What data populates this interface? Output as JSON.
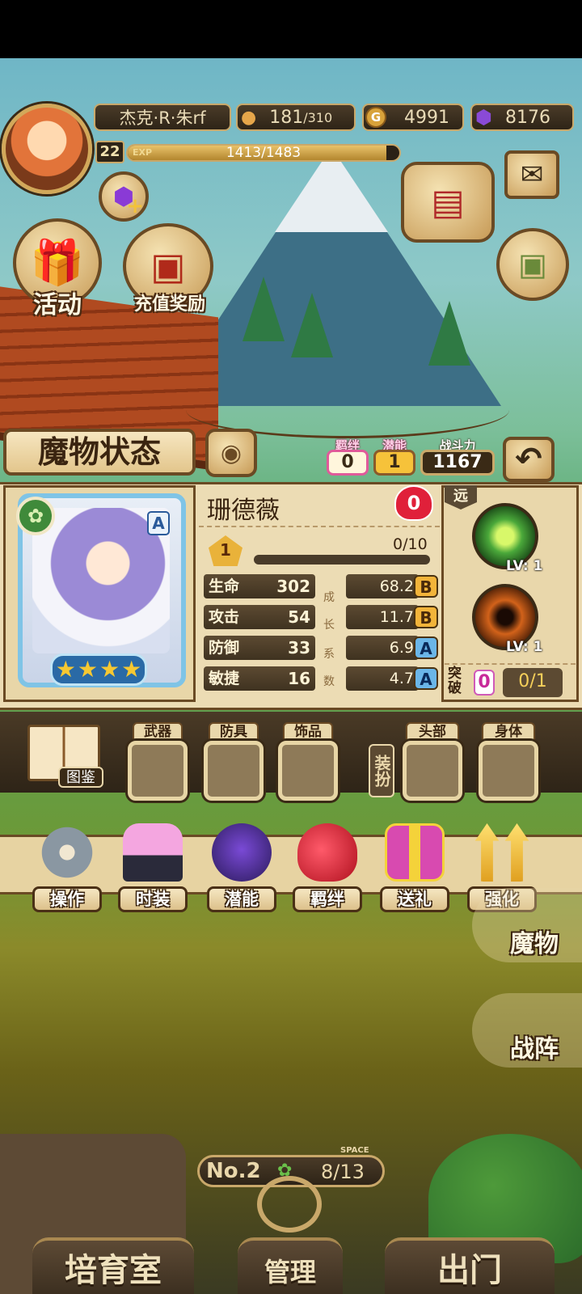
{
  "player": {
    "name": "杰克·R·朱rf",
    "level": "22",
    "exp_label": "EXP",
    "exp_text": "1413/1483",
    "exp_progress": 0.953
  },
  "resources": {
    "stamina_current": "181",
    "stamina_max": "/310",
    "gold": "4991",
    "gems": "8176"
  },
  "top_buttons": {
    "activity": "活动",
    "recharge_reward": "充值奖励"
  },
  "title": "魔物状态",
  "stats_chips": {
    "bond_label": "羁绊",
    "bond_value": "0",
    "potential_label": "潜能",
    "potential_value": "1",
    "power_label": "战斗力",
    "power_value": "1167"
  },
  "monster": {
    "name": "珊德薇",
    "rank": "A",
    "heart_count": "0",
    "star_count": 4,
    "level": "1",
    "progress_text": "0/10",
    "progress": 0.0,
    "growth_vertical": [
      "成",
      "长",
      "系",
      "数"
    ],
    "attributes": [
      {
        "name": "生命",
        "value": "302",
        "growth": "68.2",
        "grade": "B"
      },
      {
        "name": "攻击",
        "value": "54",
        "growth": "11.7",
        "grade": "B"
      },
      {
        "name": "防御",
        "value": "33",
        "growth": "6.9",
        "grade": "A"
      },
      {
        "name": "敏捷",
        "value": "16",
        "growth": "4.7",
        "grade": "A"
      }
    ],
    "attack_type": "远",
    "skills": [
      {
        "level": "LV: 1"
      },
      {
        "level": "LV: 1"
      }
    ],
    "breakthrough_label": "突破",
    "breakthrough_count": "0",
    "breakthrough_progress": "0/1"
  },
  "equipment": {
    "codex_label": "图鉴",
    "slots": [
      "武器",
      "防具",
      "饰品"
    ],
    "outfit_label": "装扮",
    "outfit_slots": [
      "头部",
      "身体"
    ]
  },
  "actions": [
    "操作",
    "时装",
    "潜能",
    "羁绊",
    "送礼",
    "强化"
  ],
  "side_tabs": [
    "魔物",
    "战阵"
  ],
  "room": {
    "no_label": "No.2",
    "space_label": "SPACE",
    "space_text": "8/13"
  },
  "bottom_nav": [
    "培育室",
    "管理",
    "出门"
  ],
  "colors": {
    "gold_border": "#c9a86a",
    "panel_bg": "#ecdcb4",
    "dark_wood": "#3a2a16",
    "grade_b": "#f2b43a",
    "grade_a": "#6bb6e8",
    "heart_red": "#e0203a",
    "chip_pink": "#e05a9a"
  }
}
